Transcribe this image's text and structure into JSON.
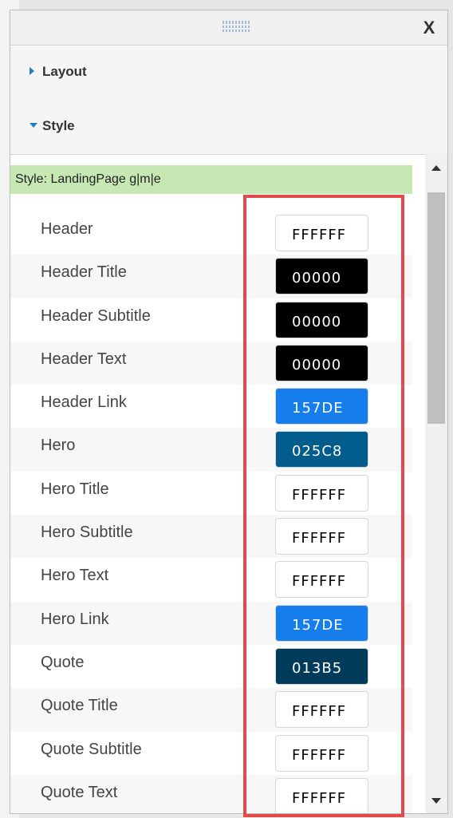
{
  "window": {
    "close_label": "X"
  },
  "sections": [
    {
      "label": "Layout",
      "expanded": false
    },
    {
      "label": "Style",
      "expanded": true
    }
  ],
  "style_banner": "Style: LandingPage g|m|e",
  "colors": {
    "highlight": "#e54a4a",
    "banner_bg": "#c7e8b3",
    "accent": "#1f7fc4"
  },
  "rows": [
    {
      "label": "Header",
      "value": "FFFFFF",
      "bg": "#ffffff",
      "fg": "#000000"
    },
    {
      "label": "Header Title",
      "value": "00000",
      "bg": "#000000",
      "fg": "#ffffff"
    },
    {
      "label": "Header Subtitle",
      "value": "00000",
      "bg": "#000000",
      "fg": "#ffffff"
    },
    {
      "label": "Header Text",
      "value": "00000",
      "bg": "#000000",
      "fg": "#ffffff"
    },
    {
      "label": "Header Link",
      "value": "157DE",
      "bg": "#157DEC",
      "fg": "#ffffff"
    },
    {
      "label": "Hero",
      "value": "025C8",
      "bg": "#025C8C",
      "fg": "#ffffff"
    },
    {
      "label": "Hero Title",
      "value": "FFFFFF",
      "bg": "#ffffff",
      "fg": "#000000"
    },
    {
      "label": "Hero Subtitle",
      "value": "FFFFFF",
      "bg": "#ffffff",
      "fg": "#000000"
    },
    {
      "label": "Hero Text",
      "value": "FFFFFF",
      "bg": "#ffffff",
      "fg": "#000000"
    },
    {
      "label": "Hero Link",
      "value": "157DE",
      "bg": "#157DEC",
      "fg": "#ffffff"
    },
    {
      "label": "Quote",
      "value": "013B5",
      "bg": "#013B5C",
      "fg": "#ffffff"
    },
    {
      "label": "Quote Title",
      "value": "FFFFFF",
      "bg": "#ffffff",
      "fg": "#000000"
    },
    {
      "label": "Quote Subtitle",
      "value": "FFFFFF",
      "bg": "#ffffff",
      "fg": "#000000"
    },
    {
      "label": "Quote Text",
      "value": "FFFFFF",
      "bg": "#ffffff",
      "fg": "#000000"
    }
  ]
}
